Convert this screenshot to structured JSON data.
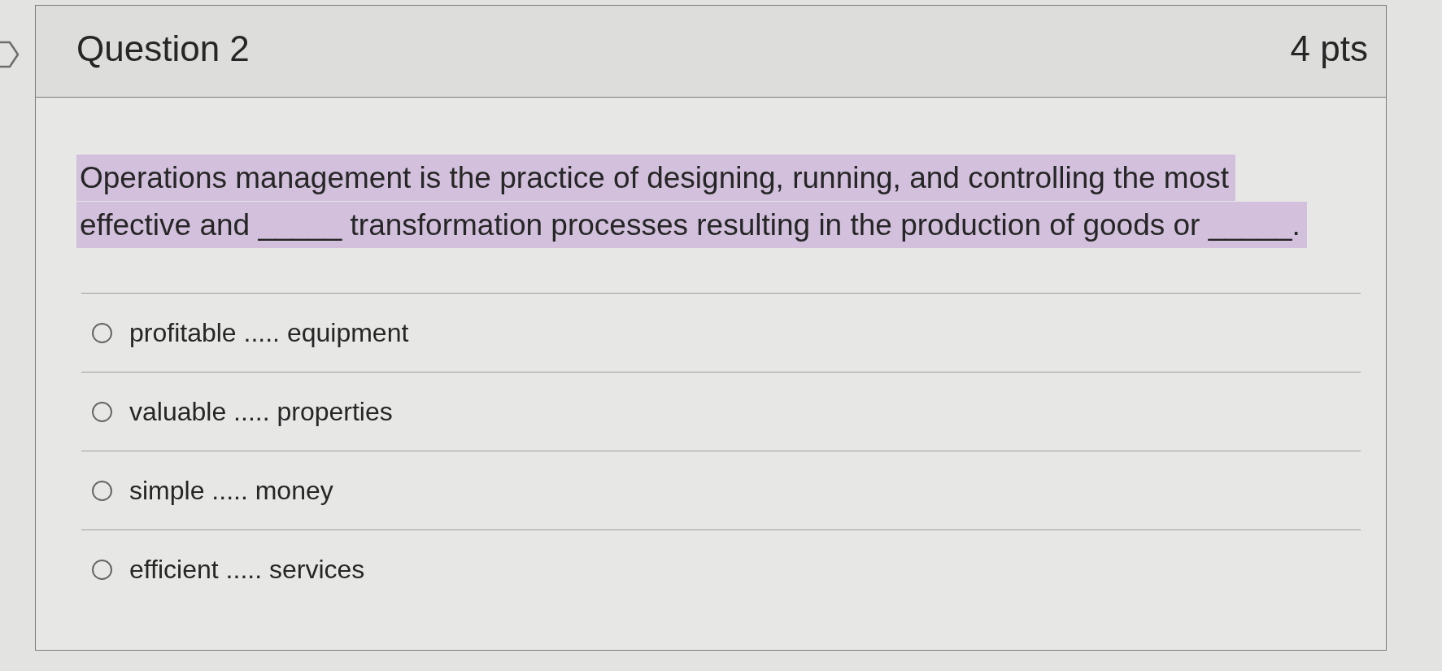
{
  "question": {
    "title": "Question 2",
    "points": "4 pts",
    "text": "Operations management is the practice of designing, running, and controlling the most effective and _____ transformation processes resulting in the production of goods or _____.",
    "highlighted": true
  },
  "answers": [
    {
      "label": "profitable ..... equipment",
      "selected": false
    },
    {
      "label": "valuable ..... properties",
      "selected": false
    },
    {
      "label": "simple ..... money",
      "selected": false
    },
    {
      "label": "efficient ..... services",
      "selected": false
    }
  ]
}
